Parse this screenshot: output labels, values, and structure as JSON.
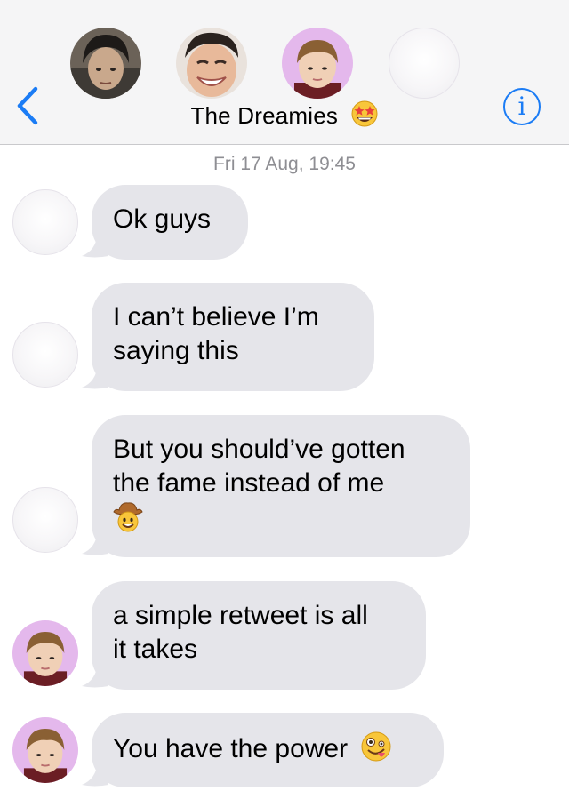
{
  "header": {
    "back_label": "Back",
    "title": "The Dreamies",
    "title_emoji": "star-struck-emoji",
    "info_label": "i"
  },
  "conversation": {
    "timestamp": "Fri 17 Aug, 19:45"
  },
  "messages": [
    {
      "text": "Ok guys"
    },
    {
      "line1": "I can’t believe I’m",
      "line2": "saying this"
    },
    {
      "line1": "But you should’ve gotten",
      "line2": "the fame instead of me",
      "emoji": "cowboy-emoji"
    },
    {
      "line1": "a simple retweet is all",
      "line2": "it takes"
    },
    {
      "text": "You have the power",
      "emoji": "zany-face-emoji"
    }
  ],
  "colors": {
    "accent": "#1b7cf5",
    "bubble": "#e5e5ea",
    "header_bg": "#f5f5f6",
    "timestamp": "#8e8e93"
  }
}
